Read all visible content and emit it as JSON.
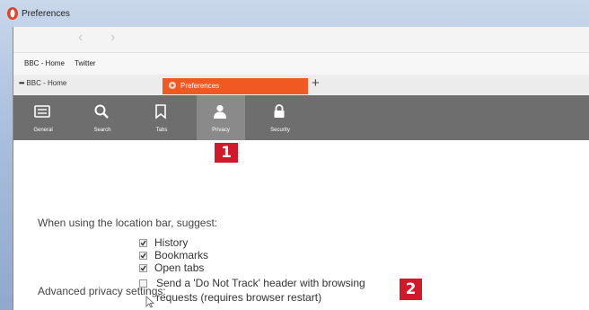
{
  "window": {
    "title": "Preferences"
  },
  "nav": {
    "back_glyph": "‹",
    "forward_glyph": "›"
  },
  "bookmarks": [
    "BBC - Home",
    "Twitter"
  ],
  "tabs": {
    "bbc": {
      "label": "BBC - Home"
    },
    "preferences": {
      "label": "Preferences",
      "color": "#f05a22"
    },
    "new_tab_glyph": "+"
  },
  "toolbar": {
    "items": [
      {
        "label": "General",
        "icon": "general-icon"
      },
      {
        "label": "Search",
        "icon": "search-icon"
      },
      {
        "label": "Tabs",
        "icon": "tabs-icon"
      },
      {
        "label": "Privacy",
        "icon": "privacy-icon",
        "selected": true
      },
      {
        "label": "Security",
        "icon": "lock-icon"
      }
    ]
  },
  "callouts": [
    "1",
    "2"
  ],
  "privacy": {
    "location_bar_heading": "When using the location bar, suggest:",
    "suggest_options": [
      {
        "label": "History",
        "checked": true
      },
      {
        "label": "Bookmarks",
        "checked": true
      },
      {
        "label": "Open tabs",
        "checked": true
      }
    ],
    "advanced_heading": "Advanced privacy settings:",
    "dnt": {
      "line1": "Send a 'Do Not Track' header with browsing",
      "line2": "requests (requires browser restart)",
      "checked": false
    }
  },
  "colors": {
    "accent": "#f05a22",
    "callout": "#d3182a",
    "toolbar": "#6e6e6e"
  }
}
